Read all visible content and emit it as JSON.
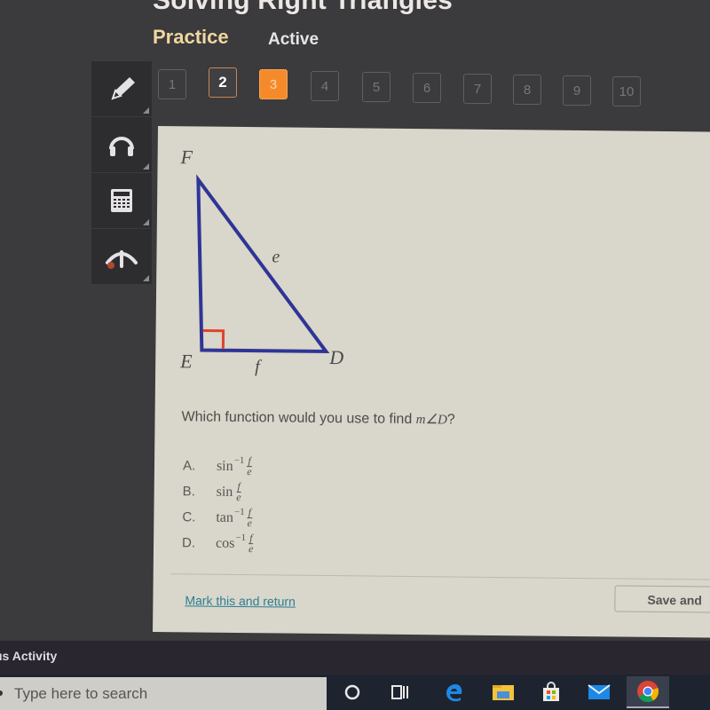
{
  "header": {
    "title": "Solving Right Triangles",
    "tab_practice": "Practice",
    "tab_active": "Active"
  },
  "question_nav": {
    "current": 3,
    "visited": [
      2
    ],
    "items": [
      "1",
      "2",
      "3",
      "4",
      "5",
      "6",
      "7",
      "8",
      "9",
      "10"
    ]
  },
  "toolbar": {
    "tools": [
      {
        "name": "pencil-icon"
      },
      {
        "name": "headphones-icon"
      },
      {
        "name": "calculator-icon"
      },
      {
        "name": "reference-icon"
      }
    ]
  },
  "diagram": {
    "vertices": {
      "F": "F",
      "E": "E",
      "D": "D"
    },
    "sides": {
      "hypotenuse": "e",
      "base": "f"
    },
    "right_angle_at": "E",
    "line_color": "#2f3596",
    "right_angle_color": "#e0432a"
  },
  "question": {
    "text": "Which function would you use to find ",
    "math": "m∠D",
    "end": "?"
  },
  "choices": [
    {
      "letter": "A.",
      "func": "sin",
      "sup": "−1",
      "num": "f",
      "den": "e"
    },
    {
      "letter": "B.",
      "func": "sin",
      "sup": "",
      "num": "f",
      "den": "e"
    },
    {
      "letter": "C.",
      "func": "tan",
      "sup": "−1",
      "num": "f",
      "den": "e"
    },
    {
      "letter": "D.",
      "func": "cos",
      "sup": "−1",
      "num": "f",
      "den": "e"
    }
  ],
  "footer": {
    "mark_link": "Mark this and return",
    "save_button": "Save and"
  },
  "activity_bar": {
    "label": "us Activity"
  },
  "taskbar": {
    "search_placeholder": "Type here to search",
    "icons": [
      "cortana-icon",
      "task-view-icon",
      "edge-icon",
      "file-explorer-icon",
      "store-icon",
      "mail-icon",
      "chrome-icon"
    ]
  }
}
